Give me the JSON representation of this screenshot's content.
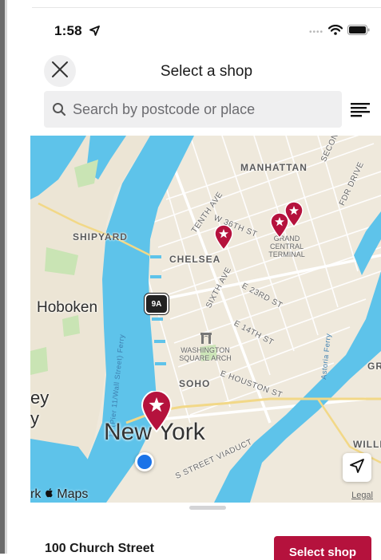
{
  "status_bar": {
    "time": "1:58"
  },
  "nav": {
    "title": "Select a shop"
  },
  "search": {
    "placeholder": "Search by postcode or place"
  },
  "map": {
    "labels": {
      "manhattan": "MANHATTAN",
      "second_ave": "SECOND AVE",
      "fdr_drive": "FDR DRIVE",
      "tenth_ave": "TENTH AVE",
      "w36th": "W 36TH ST",
      "grand_central": "GRAND CENTRAL TERMINAL",
      "shipyard": "SHIPYARD",
      "chelsea": "CHELSEA",
      "sixth_ave": "SIXTH AVE",
      "e23rd": "E 23RD ST",
      "hoboken": "Hoboken",
      "route": "9A",
      "e14th": "E 14TH ST",
      "washington_square": "WASHINGTON SQUARE ARCH",
      "soho": "SOHO",
      "e_houston": "E HOUSTON ST",
      "ferry": "11 (Pier 11/Wall Street) Ferry",
      "astoria_ferry": "Astoria Ferry",
      "new_york": "New York",
      "viaduct": "S STREET VIADUCT",
      "jersey_fragment_1": "ey",
      "jersey_fragment_2": "y",
      "gr_fragment": "GR",
      "willi_fragment": "WILLIA",
      "maps_brand": "Maps",
      "maps_prefix": "rk",
      "legal": "Legal"
    },
    "colors": {
      "land": "#efe9dc",
      "water": "#5ec3ea",
      "pin": "#b5123d",
      "user": "#1a73e8"
    }
  },
  "shop": {
    "address": "100 Church Street",
    "button_label": "Select shop"
  }
}
